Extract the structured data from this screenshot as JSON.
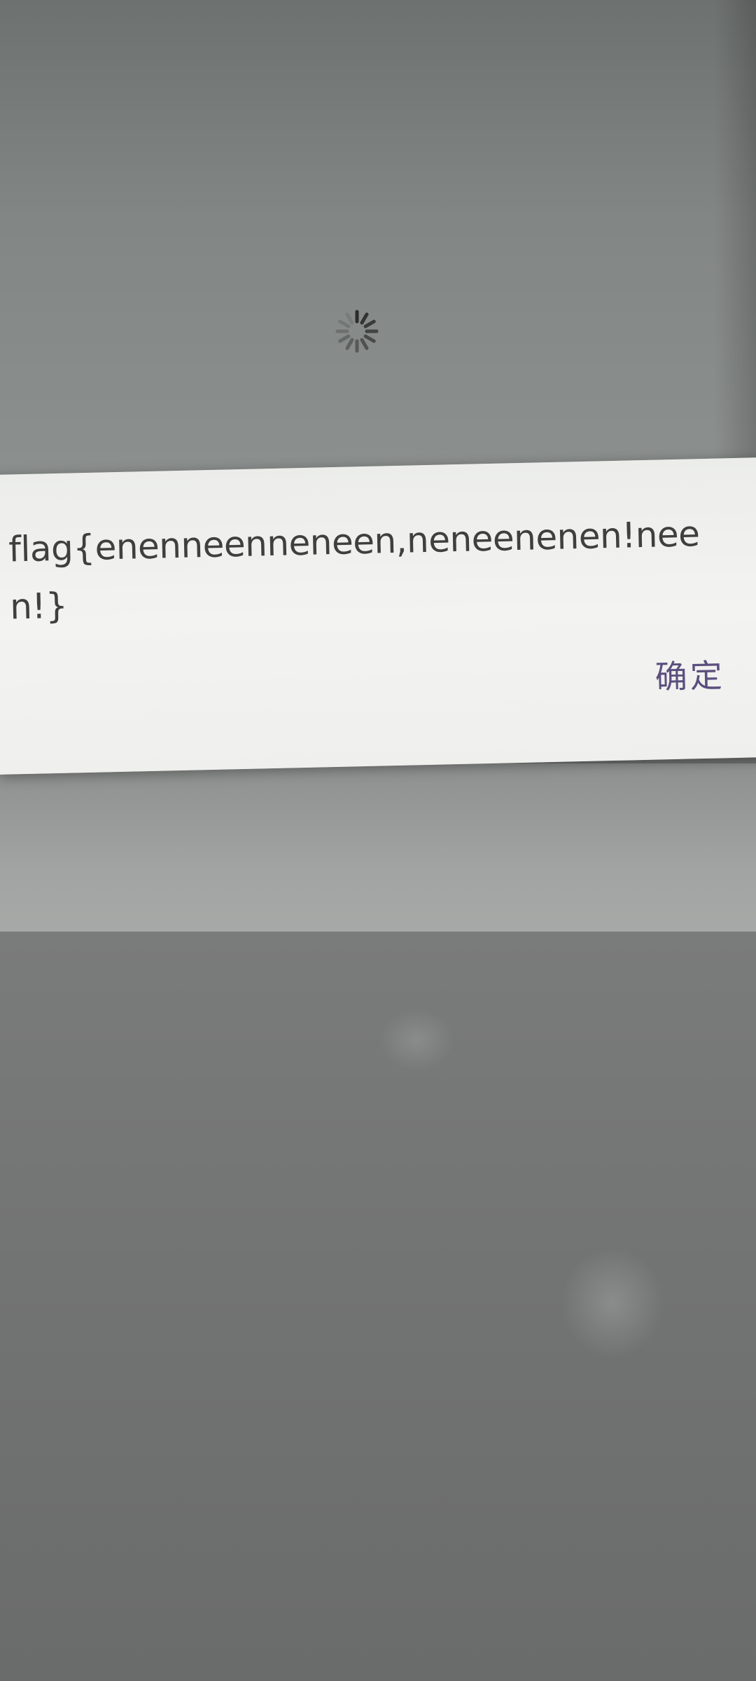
{
  "dialog": {
    "message": "flag{enenneenneneen,neneenenen!neen!}",
    "ok_label": "确定"
  },
  "loading": {
    "icon": "spinner-icon"
  },
  "colors": {
    "dialog_background": "#f1f1ef",
    "message_text": "#3f3f3f",
    "ok_button_text": "#5b4f7e",
    "scrim": "#7c807e"
  }
}
